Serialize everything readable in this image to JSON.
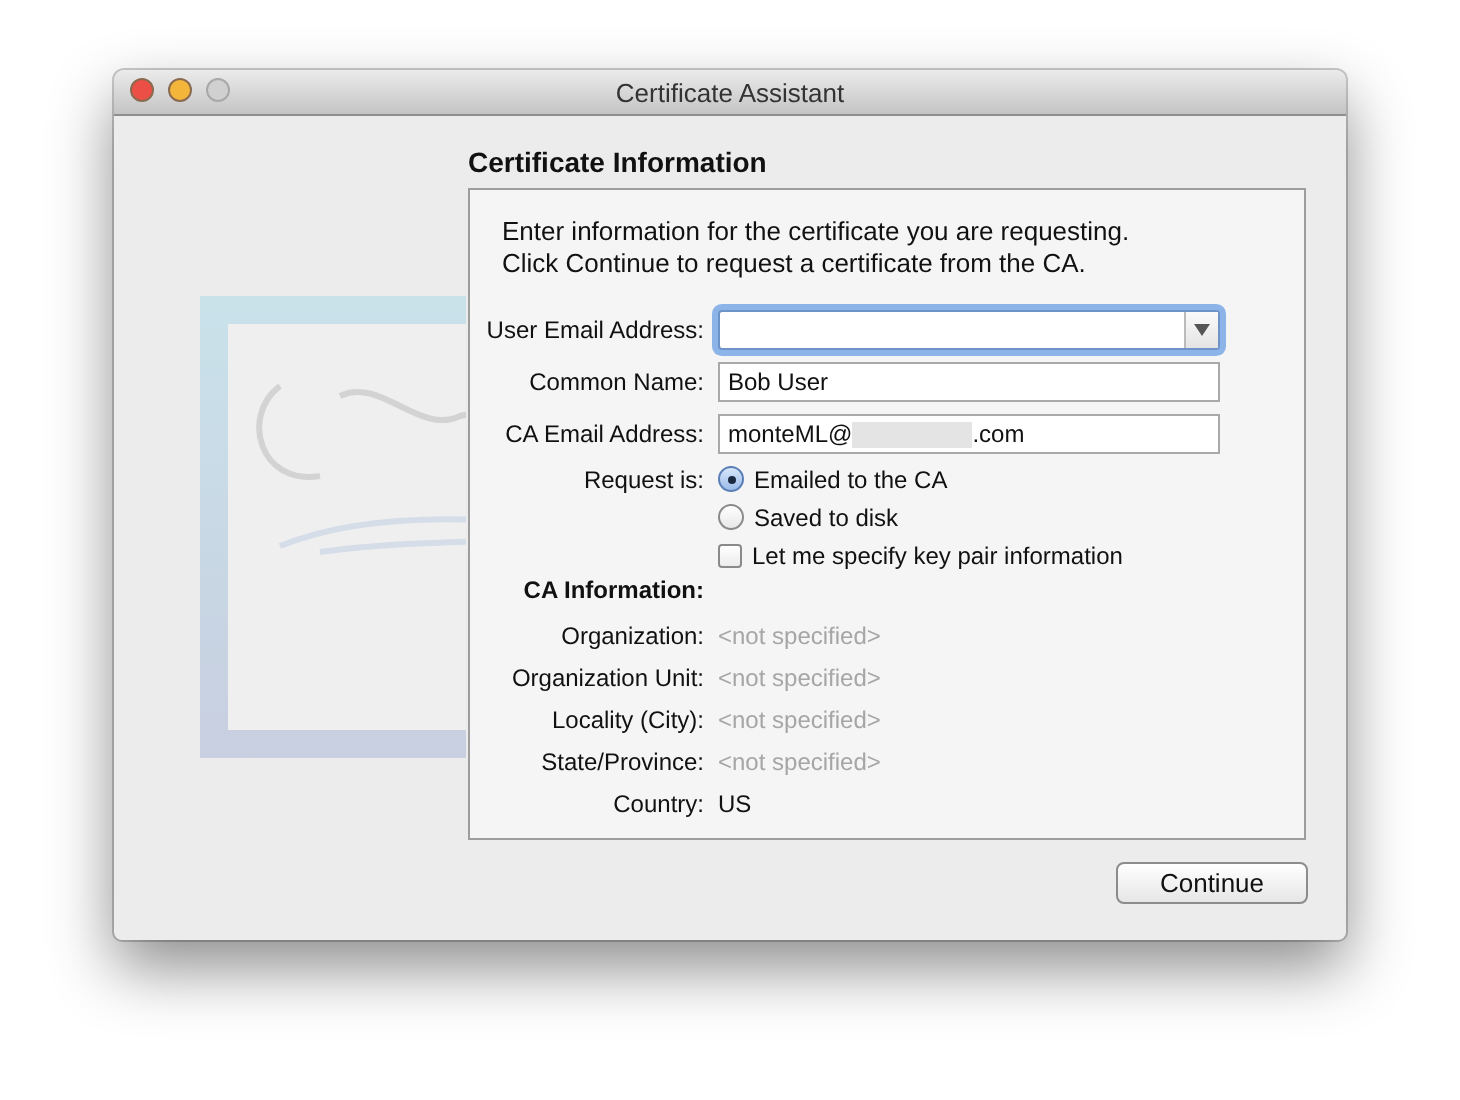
{
  "window": {
    "title": "Certificate Assistant",
    "controls": [
      {
        "kind": "close",
        "disabled": false
      },
      {
        "kind": "minimize",
        "disabled": false
      },
      {
        "kind": "zoom",
        "disabled": true
      }
    ]
  },
  "heading": "Certificate Information",
  "intro": [
    "Enter information for the certificate you are requesting.",
    "Click Continue to request a certificate from the CA."
  ],
  "form": [
    {
      "kind": "combo",
      "label": "User Email Address:",
      "focused": true
    },
    {
      "kind": "text",
      "label": "Common Name:",
      "value": "Bob User",
      "focused": false
    },
    {
      "kind": "text",
      "label": "CA Email Address:",
      "value": "monteML@",
      "redacted": true,
      "value_suffix": ".com",
      "focused": false
    },
    {
      "kind": "radio",
      "label": "Request is:",
      "options": [
        {
          "label": "Emailed to the CA",
          "selected": true
        },
        {
          "label": "Saved to disk",
          "selected": false
        }
      ]
    },
    {
      "kind": "checkbox",
      "label": "Let me specify key pair information",
      "checked": false
    },
    {
      "kind": "section",
      "label": "CA Information:"
    },
    {
      "kind": "info",
      "label": "Organization:",
      "value": "<not specified>",
      "dimmed": true
    },
    {
      "kind": "info",
      "label": "Organization Unit:",
      "value": "<not specified>",
      "dimmed": true
    },
    {
      "kind": "info",
      "label": "Locality (City):",
      "value": "<not specified>",
      "dimmed": true
    },
    {
      "kind": "info",
      "label": "State/Province:",
      "value": "<not specified>",
      "dimmed": true
    },
    {
      "kind": "info",
      "label": "Country:",
      "value": "US",
      "dimmed": false
    }
  ],
  "buttons": [
    {
      "label": "Continue"
    }
  ]
}
